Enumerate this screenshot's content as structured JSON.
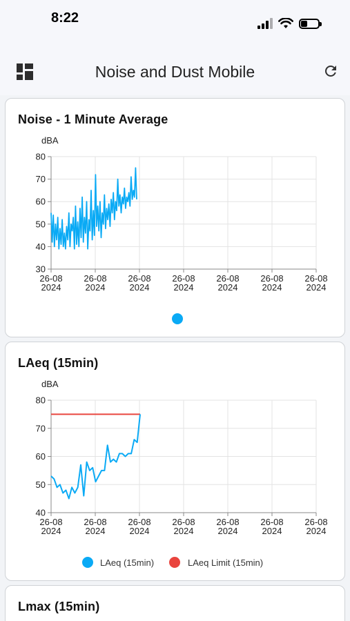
{
  "status_bar": {
    "time": "8:22"
  },
  "header": {
    "title": "Noise and Dust Mobile",
    "menu_icon": "dashboard-grid-icon",
    "refresh_icon": "refresh-icon"
  },
  "colors": {
    "series": "#0aaaf5",
    "limit": "#e9443d",
    "grid": "#e3e3e3",
    "axis": "#888888"
  },
  "cards": [
    {
      "title": "Noise - 1 Minute Average"
    },
    {
      "title": "LAeq (15min)"
    },
    {
      "title": "Lmax (15min)"
    }
  ],
  "chart_data": [
    {
      "type": "line",
      "title": "Noise - 1 Minute Average",
      "ylabel": "dBA",
      "ylim": [
        30,
        80
      ],
      "yticks": [
        "80",
        "70",
        "60",
        "50",
        "40",
        "30"
      ],
      "xtick_labels": [
        [
          "26-08",
          "2024"
        ],
        [
          "26-08",
          "2024"
        ],
        [
          "26-08",
          "2024"
        ],
        [
          "26-08",
          "2024"
        ],
        [
          "26-08",
          "2024"
        ],
        [
          "26-08",
          "2024"
        ],
        [
          "26-08",
          "2024"
        ]
      ],
      "grid": true,
      "legend": "bottom",
      "series": [
        {
          "values": [
            55,
            42,
            54,
            40,
            50,
            43,
            53,
            39,
            48,
            41,
            52,
            40,
            46,
            39,
            49,
            43,
            55,
            40,
            50,
            47,
            53,
            39,
            58,
            41,
            51,
            40,
            57,
            44,
            62,
            42,
            53,
            46,
            60,
            39,
            52,
            47,
            65,
            43,
            56,
            45,
            72,
            49,
            58,
            47,
            60,
            44,
            55,
            50,
            63,
            48,
            57,
            52,
            59,
            49,
            61,
            55,
            64,
            52,
            60,
            56,
            70,
            58,
            63,
            55,
            62,
            59,
            66,
            57,
            62,
            60,
            64,
            58,
            71,
            61,
            65,
            62,
            75,
            61
          ]
        }
      ]
    },
    {
      "type": "line",
      "title": "LAeq (15min)",
      "ylabel": "dBA",
      "ylim": [
        40,
        80
      ],
      "yticks": [
        "80",
        "70",
        "60",
        "50",
        "40"
      ],
      "xtick_labels": [
        [
          "26-08",
          "2024"
        ],
        [
          "26-08",
          "2024"
        ],
        [
          "26-08",
          "2024"
        ],
        [
          "26-08",
          "2024"
        ],
        [
          "26-08",
          "2024"
        ],
        [
          "26-08",
          "2024"
        ],
        [
          "26-08",
          "2024"
        ]
      ],
      "grid": true,
      "legend": "bottom",
      "series": [
        {
          "name": "LAeq (15min)",
          "values": [
            53,
            52,
            49,
            50,
            47,
            48,
            45,
            49,
            47,
            49,
            57,
            46,
            58,
            55,
            56,
            51,
            53,
            55,
            55,
            64,
            58,
            59,
            58,
            61,
            61,
            60,
            61,
            61,
            66,
            65,
            75
          ]
        },
        {
          "name": "LAeq Limit (15min)",
          "values": [
            75,
            75
          ]
        }
      ]
    }
  ]
}
